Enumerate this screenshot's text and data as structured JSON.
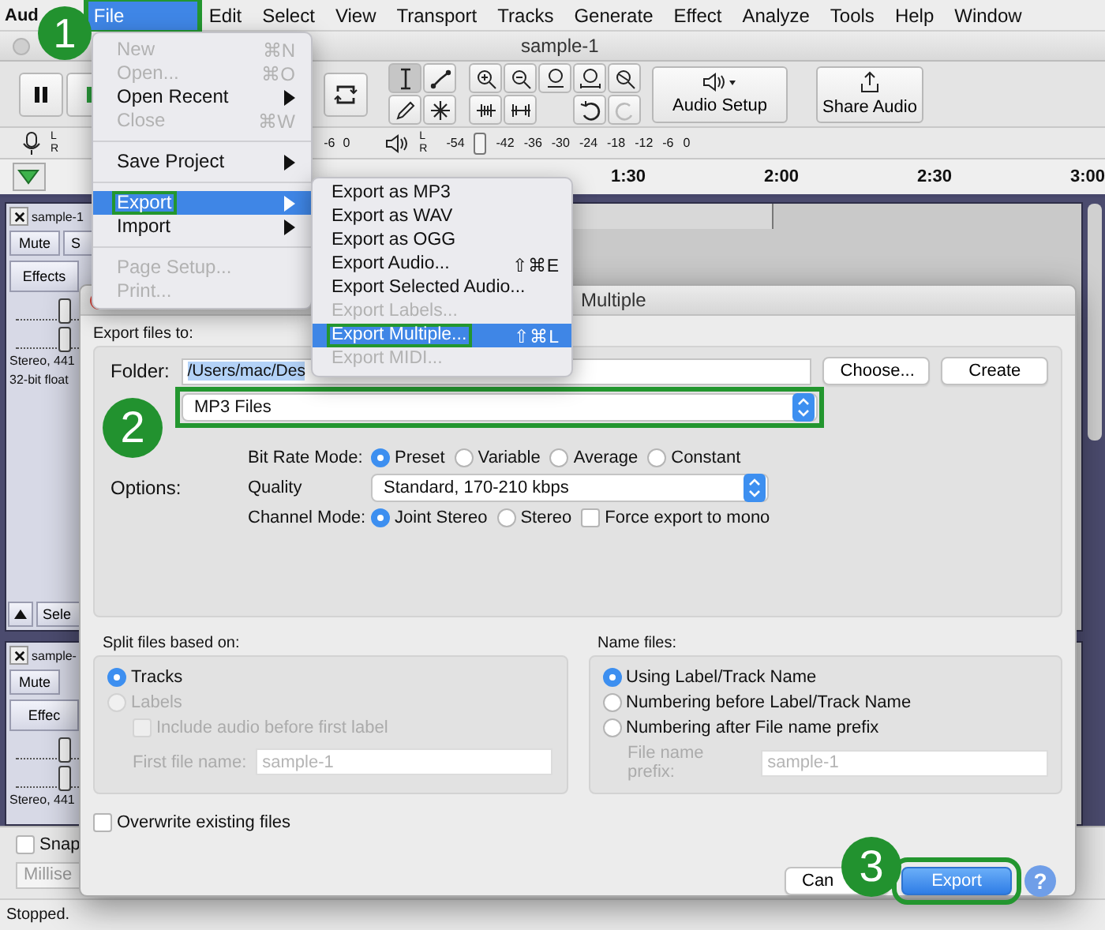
{
  "menu_bar": {
    "app_name": "Aud",
    "items": [
      {
        "label": "File",
        "selected": true,
        "callout": true
      },
      {
        "label": "Edit",
        "selected": false,
        "callout": false
      },
      {
        "label": "Select",
        "selected": false,
        "callout": false
      },
      {
        "label": "View",
        "selected": false,
        "callout": false
      },
      {
        "label": "Transport",
        "selected": false,
        "callout": false
      },
      {
        "label": "Tracks",
        "selected": false,
        "callout": false
      },
      {
        "label": "Generate",
        "selected": false,
        "callout": false
      },
      {
        "label": "Effect",
        "selected": false,
        "callout": false
      },
      {
        "label": "Analyze",
        "selected": false,
        "callout": false
      },
      {
        "label": "Tools",
        "selected": false,
        "callout": false
      },
      {
        "label": "Help",
        "selected": false,
        "callout": false
      },
      {
        "label": "Window",
        "selected": false,
        "callout": false
      }
    ]
  },
  "window": {
    "title": "sample-1"
  },
  "toolbar": {
    "audio_setup": "Audio Setup",
    "share_audio": "Share Audio"
  },
  "meters": {
    "record_channels": [
      "L",
      "R"
    ],
    "playback_channels": [
      "L",
      "R"
    ],
    "record_scale": [
      "-6",
      "0"
    ],
    "playback_scale": [
      "-54",
      "-42",
      "-36",
      "-30",
      "-24",
      "-18",
      "-12",
      "-6",
      "0"
    ]
  },
  "timeline": {
    "labels": [
      "1:30",
      "2:00",
      "2:30",
      "3:00"
    ]
  },
  "tracks": [
    {
      "name": "sample-1",
      "mute": "Mute",
      "solo": "S",
      "effects": "Effects",
      "gain": {
        "level": 0.8
      },
      "pan": {
        "level": 0.8
      },
      "info": [
        "Stereo, 441",
        "32-bit float"
      ],
      "select": "Sele"
    },
    {
      "name": "sample-",
      "mute": "Mute",
      "effects": "Effec",
      "gain": {
        "level": 0.8
      },
      "pan": {
        "level": 0.8
      },
      "info": [
        "Stereo, 441"
      ]
    }
  ],
  "bottom_bar": {
    "snap": {
      "label": "Snap",
      "checked": false
    },
    "time_format": "Millise"
  },
  "status_bar": "Stopped.",
  "file_menu": {
    "items": [
      {
        "kind": "item",
        "label": "New",
        "shortcut": "⌘N",
        "disabled": true,
        "submenu": false,
        "selected": false,
        "callout": false
      },
      {
        "kind": "item",
        "label": "Open...",
        "shortcut": "⌘O",
        "disabled": true,
        "submenu": false,
        "selected": false,
        "callout": false
      },
      {
        "kind": "item",
        "label": "Open Recent",
        "disabled": false,
        "submenu": true,
        "selected": false,
        "callout": false
      },
      {
        "kind": "item",
        "label": "Close",
        "shortcut": "⌘W",
        "disabled": true,
        "submenu": false,
        "selected": false,
        "callout": false
      },
      {
        "kind": "separator"
      },
      {
        "kind": "item",
        "label": "Save Project",
        "disabled": false,
        "submenu": true,
        "selected": false,
        "callout": false
      },
      {
        "kind": "separator"
      },
      {
        "kind": "item",
        "label": "Export",
        "disabled": false,
        "submenu": true,
        "selected": true,
        "callout": true
      },
      {
        "kind": "item",
        "label": "Import",
        "disabled": false,
        "submenu": true,
        "selected": false,
        "callout": false
      },
      {
        "kind": "separator"
      },
      {
        "kind": "item",
        "label": "Page Setup...",
        "disabled": true,
        "submenu": false,
        "selected": false,
        "callout": false
      },
      {
        "kind": "item",
        "label": "Print...",
        "disabled": true,
        "submenu": false,
        "selected": false,
        "callout": false
      }
    ]
  },
  "export_submenu": {
    "items": [
      {
        "kind": "item",
        "label": "Export as MP3",
        "disabled": false,
        "submenu": false,
        "selected": false,
        "callout": false
      },
      {
        "kind": "item",
        "label": "Export as WAV",
        "disabled": false,
        "submenu": false,
        "selected": false,
        "callout": false
      },
      {
        "kind": "item",
        "label": "Export as OGG",
        "disabled": false,
        "submenu": false,
        "selected": false,
        "callout": false
      },
      {
        "kind": "item",
        "label": "Export Audio...",
        "shortcut": "⇧⌘E",
        "disabled": false,
        "submenu": false,
        "selected": false,
        "callout": false
      },
      {
        "kind": "item",
        "label": "Export Selected Audio...",
        "disabled": false,
        "submenu": false,
        "selected": false,
        "callout": false
      },
      {
        "kind": "item",
        "label": "Export Labels...",
        "disabled": true,
        "submenu": false,
        "selected": false,
        "callout": false
      },
      {
        "kind": "item",
        "label": "Export Multiple...",
        "shortcut": "⇧⌘L",
        "disabled": false,
        "submenu": false,
        "selected": true,
        "callout": true
      },
      {
        "kind": "item",
        "label": "Export MIDI...",
        "disabled": true,
        "submenu": false,
        "selected": false,
        "callout": false
      }
    ]
  },
  "dialog": {
    "title": "Multiple",
    "export_to_label": "Export files to:",
    "folder": {
      "label": "Folder:",
      "value": "/Users/mac/Des",
      "text_selected": true
    },
    "choose": "Choose...",
    "create": "Create",
    "format": {
      "value": "MP3 Files",
      "callout": true
    },
    "options_label": "Options:",
    "bit_rate": {
      "label": "Bit Rate Mode:",
      "options": [
        {
          "label": "Preset",
          "selected": true
        },
        {
          "label": "Variable",
          "selected": false
        },
        {
          "label": "Average",
          "selected": false
        },
        {
          "label": "Constant",
          "selected": false
        }
      ]
    },
    "quality": {
      "label": "Quality",
      "value": "Standard, 170-210 kbps"
    },
    "channel_mode": {
      "label": "Channel Mode:",
      "options": [
        {
          "label": "Joint Stereo",
          "selected": true
        },
        {
          "label": "Stereo",
          "selected": false
        }
      ]
    },
    "force_mono": {
      "label": "Force export to mono",
      "checked": false
    },
    "split": {
      "label": "Split files based on:",
      "options": [
        {
          "label": "Tracks",
          "selected": true,
          "disabled": false
        },
        {
          "label": "Labels",
          "selected": false,
          "disabled": true
        }
      ],
      "include_audio": {
        "label": "Include audio before first label",
        "checked": false,
        "disabled": true
      },
      "first_file_name": {
        "label": "First file name:",
        "placeholder": "sample-1",
        "disabled": true
      }
    },
    "name_files": {
      "label": "Name files:",
      "options": [
        {
          "label": "Using Label/Track Name",
          "selected": true,
          "disabled": false
        },
        {
          "label": "Numbering before Label/Track Name",
          "selected": false,
          "disabled": false
        },
        {
          "label": "Numbering after File name prefix",
          "selected": false,
          "disabled": false
        }
      ],
      "prefix": {
        "label": "File name prefix:",
        "placeholder": "sample-1",
        "disabled": true
      }
    },
    "overwrite": {
      "label": "Overwrite existing files",
      "checked": false
    },
    "cancel": "Can",
    "export": {
      "label": "Export",
      "callout": true
    },
    "help": "?"
  },
  "callouts": [
    "1",
    "2",
    "3"
  ]
}
